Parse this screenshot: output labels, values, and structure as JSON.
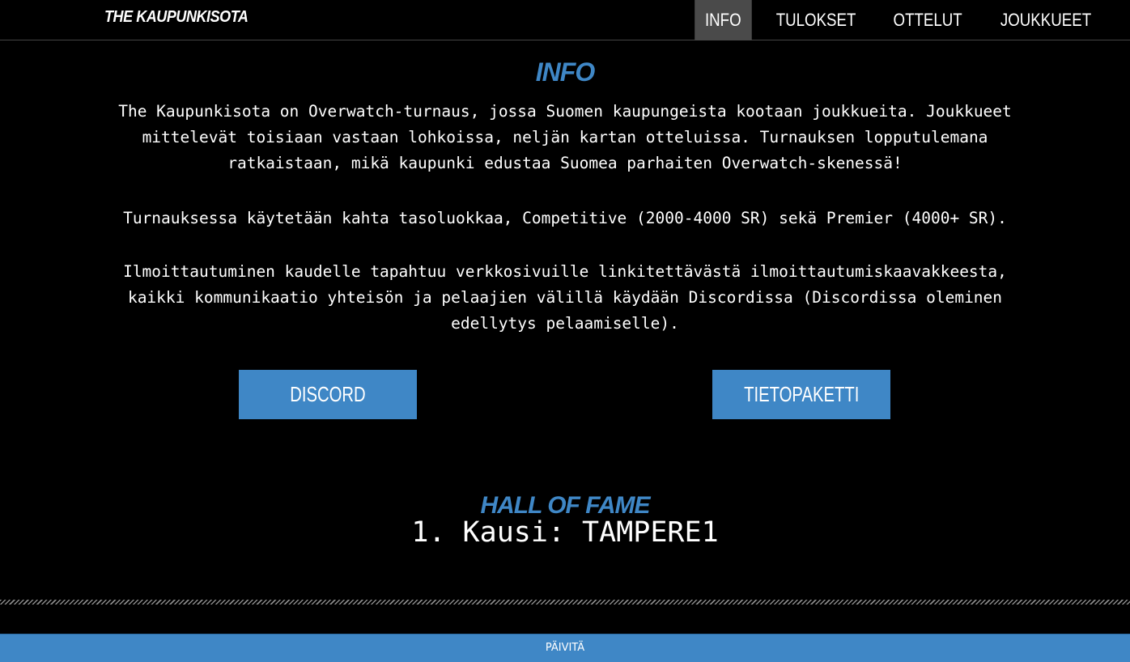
{
  "brand": "THE KAUPUNKISOTA",
  "nav": {
    "items": [
      {
        "label": "INFO",
        "active": true
      },
      {
        "label": "TULOKSET",
        "active": false
      },
      {
        "label": "OTTELUT",
        "active": false
      },
      {
        "label": "JOUKKUEET",
        "active": false
      }
    ]
  },
  "info": {
    "heading": "INFO",
    "paragraphs": [
      "The Kaupunkisota on Overwatch-turnaus, jossa Suomen kaupungeista kootaan joukkueita. Joukkueet mittelevät toisiaan vastaan lohkoissa, neljän kartan otteluissa. Turnauksen lopputulemana ratkaistaan, mikä kaupunki edustaa Suomea parhaiten Overwatch-skenessä!",
      "Turnauksessa käytetään kahta tasoluokkaa, Competitive (2000-4000 SR) sekä Premier (4000+ SR).",
      "Ilmoittautuminen kaudelle tapahtuu verkkosivuille linkitettävästä ilmoittautumiskaavakkeesta, kaikki kommunikaatio yhteisön ja pelaajien välillä käydään Discordissa (Discordissa oleminen edellytys pelaamiselle)."
    ],
    "buttons": {
      "discord": "DISCORD",
      "tietopaketti": "TIETOPAKETTI"
    }
  },
  "hall_of_fame": {
    "heading": "HALL OF FAME",
    "entries": [
      "1. Kausi: TAMPERE1"
    ]
  },
  "footer": {
    "refresh_label": "PÄIVITÄ"
  },
  "colors": {
    "accent": "#3f87c6",
    "background": "#000000",
    "nav_active": "#4a4a4a",
    "text": "#ffffff"
  }
}
